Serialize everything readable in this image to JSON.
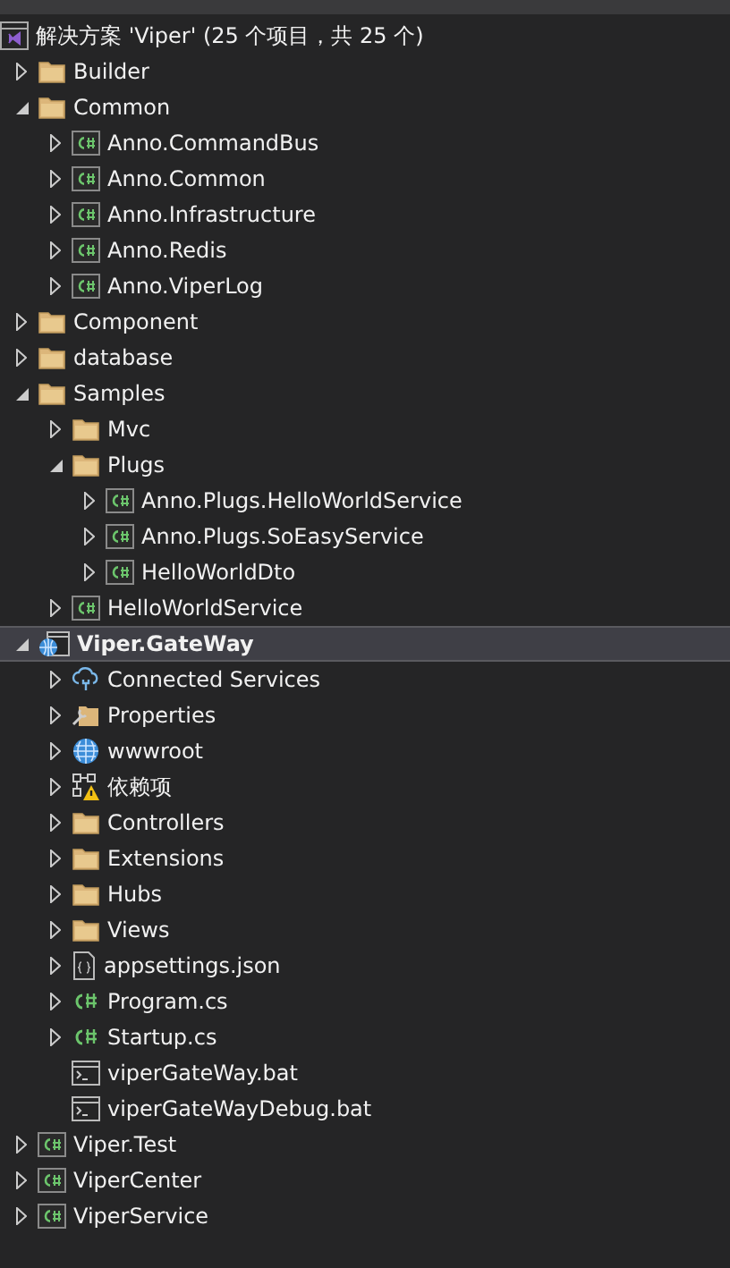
{
  "solution": {
    "label": "解决方案 'Viper' (25 个项目，共 25 个)",
    "selected": false,
    "children": [
      {
        "label": "Builder",
        "kind": "folder",
        "expanded": false,
        "selected": false
      },
      {
        "label": "Common",
        "kind": "folder",
        "expanded": true,
        "selected": false,
        "children": [
          {
            "label": "Anno.CommandBus",
            "kind": "csproj",
            "expanded": false,
            "selected": false
          },
          {
            "label": "Anno.Common",
            "kind": "csproj",
            "expanded": false,
            "selected": false
          },
          {
            "label": "Anno.Infrastructure",
            "kind": "csproj",
            "expanded": false,
            "selected": false
          },
          {
            "label": "Anno.Redis",
            "kind": "csproj",
            "expanded": false,
            "selected": false
          },
          {
            "label": "Anno.ViperLog",
            "kind": "csproj",
            "expanded": false,
            "selected": false
          }
        ]
      },
      {
        "label": "Component",
        "kind": "folder",
        "expanded": false,
        "selected": false
      },
      {
        "label": "database",
        "kind": "folder",
        "expanded": false,
        "selected": false
      },
      {
        "label": "Samples",
        "kind": "folder",
        "expanded": true,
        "selected": false,
        "children": [
          {
            "label": "Mvc",
            "kind": "folder",
            "expanded": false,
            "selected": false
          },
          {
            "label": "Plugs",
            "kind": "folder",
            "expanded": true,
            "selected": false,
            "children": [
              {
                "label": "Anno.Plugs.HelloWorldService",
                "kind": "csproj",
                "expanded": false,
                "selected": false
              },
              {
                "label": "Anno.Plugs.SoEasyService",
                "kind": "csproj",
                "expanded": false,
                "selected": false
              },
              {
                "label": "HelloWorldDto",
                "kind": "csproj",
                "expanded": false,
                "selected": false
              }
            ]
          },
          {
            "label": "HelloWorldService",
            "kind": "csproj",
            "expanded": false,
            "selected": false
          }
        ]
      },
      {
        "label": "Viper.GateWay",
        "kind": "webproj",
        "expanded": true,
        "selected": true,
        "children": [
          {
            "label": "Connected Services",
            "kind": "connected",
            "expanded": false,
            "selected": false
          },
          {
            "label": "Properties",
            "kind": "properties",
            "expanded": false,
            "selected": false
          },
          {
            "label": "wwwroot",
            "kind": "globe",
            "expanded": false,
            "selected": false
          },
          {
            "label": "依赖项",
            "kind": "deps",
            "expanded": false,
            "selected": false
          },
          {
            "label": "Controllers",
            "kind": "folder",
            "expanded": false,
            "selected": false
          },
          {
            "label": "Extensions",
            "kind": "folder",
            "expanded": false,
            "selected": false
          },
          {
            "label": "Hubs",
            "kind": "folder",
            "expanded": false,
            "selected": false
          },
          {
            "label": "Views",
            "kind": "folder",
            "expanded": false,
            "selected": false
          },
          {
            "label": "appsettings.json",
            "kind": "json",
            "expanded": false,
            "selected": false
          },
          {
            "label": "Program.cs",
            "kind": "cs",
            "expanded": false,
            "selected": false
          },
          {
            "label": "Startup.cs",
            "kind": "cs",
            "expanded": false,
            "selected": false
          },
          {
            "label": "viperGateWay.bat",
            "kind": "bat",
            "selected": false
          },
          {
            "label": "viperGateWayDebug.bat",
            "kind": "bat",
            "selected": false
          }
        ]
      },
      {
        "label": "Viper.Test",
        "kind": "csproj",
        "expanded": false,
        "selected": false
      },
      {
        "label": "ViperCenter",
        "kind": "csproj",
        "expanded": false,
        "selected": false
      },
      {
        "label": "ViperService",
        "kind": "csproj",
        "expanded": false,
        "selected": false
      }
    ]
  }
}
